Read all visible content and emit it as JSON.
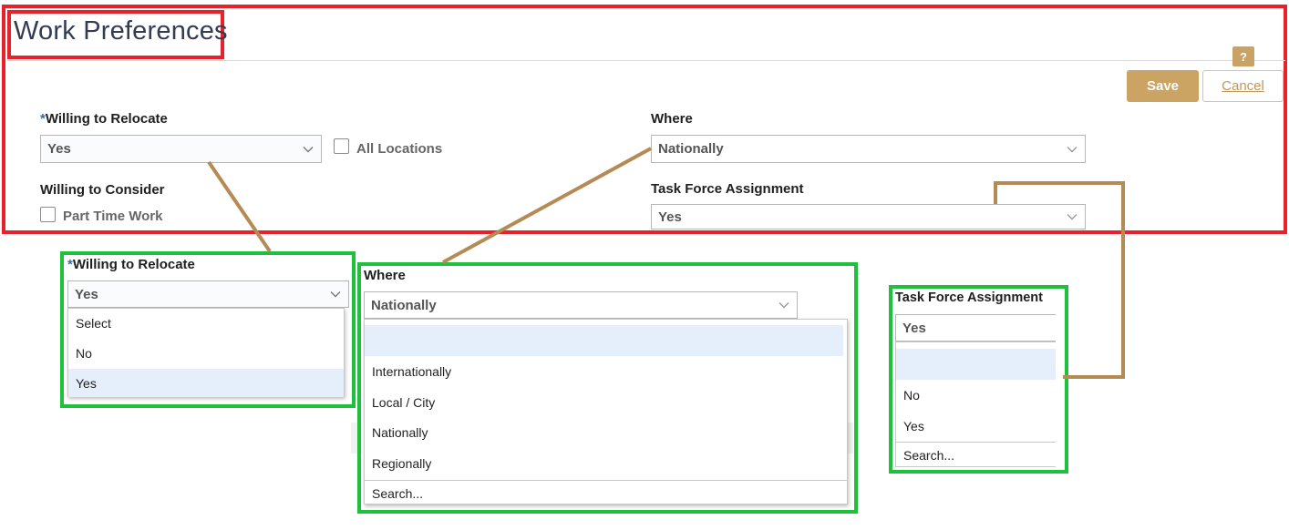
{
  "page": {
    "title": "Work Preferences"
  },
  "actions": {
    "help_label": "?",
    "save_label": "Save",
    "cancel_label": "Cancel"
  },
  "form": {
    "relocate": {
      "required_mark": "*",
      "label": "Willing to Relocate",
      "value": "Yes"
    },
    "all_locations": {
      "label": "All Locations",
      "checked": false
    },
    "consider": {
      "label": "Willing to Consider"
    },
    "part_time": {
      "label": "Part Time Work",
      "checked": false
    },
    "where": {
      "label": "Where",
      "value": "Nationally"
    },
    "task_force": {
      "label": "Task Force Assignment",
      "value": "Yes"
    }
  },
  "callouts": {
    "relocate": {
      "required_mark": "*",
      "label": "Willing to Relocate",
      "value": "Yes",
      "options": [
        "Select",
        "No",
        "Yes"
      ],
      "highlighted": "Yes"
    },
    "where": {
      "label": "Where",
      "value": "Nationally",
      "options": [
        "",
        "Internationally",
        "Local / City",
        "Nationally",
        "Regionally"
      ],
      "search": "Search..."
    },
    "task_force": {
      "label": "Task Force Assignment",
      "value": "Yes",
      "options": [
        "",
        "No",
        "Yes"
      ],
      "search": "Search..."
    }
  },
  "colors": {
    "annotation_red": "#e8212b",
    "annotation_green": "#1fc03b",
    "connector": "#b58a55",
    "accent_gold": "#cba363",
    "highlight": "#e4effb"
  }
}
